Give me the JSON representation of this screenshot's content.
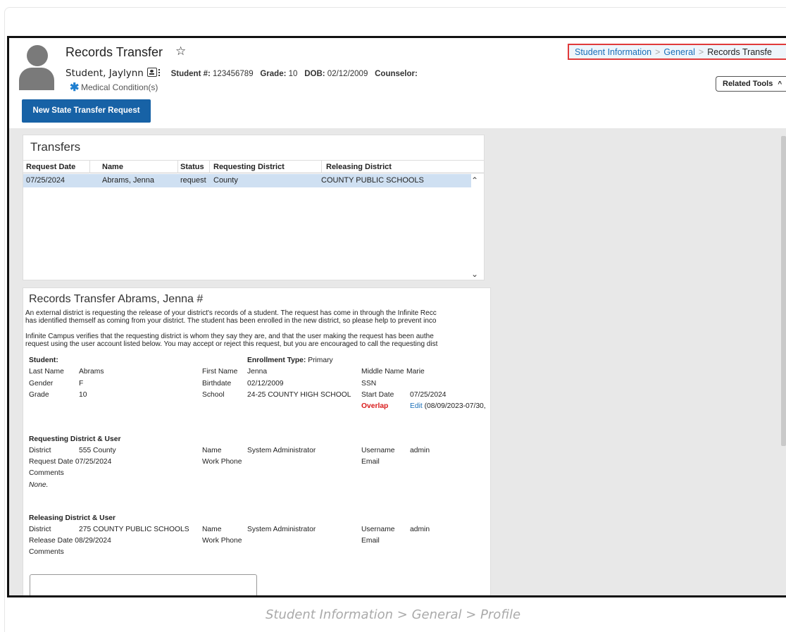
{
  "header": {
    "title": "Records Transfer",
    "student_name": "Student, Jaylynn",
    "student_num_label": "Student #:",
    "student_num": "123456789",
    "grade_label": "Grade:",
    "grade": "10",
    "dob_label": "DOB:",
    "dob": "02/12/2009",
    "counselor_label": "Counselor:",
    "medical": "Medical Condition(s)"
  },
  "breadcrumb": {
    "item1": "Student Information",
    "item2": "General",
    "item3": "Records Transfe"
  },
  "related_tools": "Related Tools",
  "new_button": "New State Transfer Request",
  "transfers": {
    "title": "Transfers",
    "columns": [
      "Request Date",
      "Name",
      "Status",
      "Requesting District",
      "Releasing District"
    ],
    "rows": [
      [
        "07/25/2024",
        "Abrams, Jenna",
        "request",
        "County",
        "COUNTY PUBLIC SCHOOLS"
      ]
    ]
  },
  "records": {
    "title": "Records Transfer Abrams, Jenna #",
    "para1_line1": "An external district is requesting the release of your district's records of a student. The request has come in through the Infinite Recc",
    "para1_line2": "has identified themself as coming from your district. The student has been enrolled in the new district, so please help to prevent inco",
    "para2_line1": "Infinite Campus verifies that the requesting district is whom they say they are, and that the user making the request has been authe",
    "para2_line2": "request using the user account listed below. You may accept or reject this request, but you are encouraged to call the requesting dist",
    "student_label": "Student:",
    "enrollment_type_label": "Enrollment Type:",
    "enrollment_type": "Primary",
    "last_name_label": "Last Name",
    "last_name": "Abrams",
    "first_name_label": "First Name",
    "first_name": "Jenna",
    "middle_name_label": "Middle Name",
    "middle_name": "Marie",
    "gender_label": "Gender",
    "gender": "F",
    "birthdate_label": "Birthdate",
    "birthdate": "02/12/2009",
    "ssn_label": "SSN",
    "grade_label": "Grade",
    "grade": "10",
    "school_label": "School",
    "school": "24-25 COUNTY HIGH SCHOOL",
    "start_date_label": "Start Date",
    "start_date": "07/25/2024",
    "overlap": "Overlap",
    "edit": "Edit",
    "edit_range": "(08/09/2023-07/30,",
    "req_heading": "Requesting District & User",
    "district_label": "District",
    "req_district": "555 County",
    "name_label": "Name",
    "req_name": "System Administrator",
    "username_label": "Username",
    "req_username": "admin",
    "request_date_label": "Request Date",
    "request_date": "07/25/2024",
    "work_phone_label": "Work Phone",
    "email_label": "Email",
    "comments_label": "Comments",
    "req_comments": "None.",
    "rel_heading": "Releasing District & User",
    "rel_district": "275 COUNTY PUBLIC SCHOOLS",
    "rel_name": "System Administrator",
    "rel_username": "admin",
    "release_date_label": "Release Date",
    "release_date": "08/29/2024"
  },
  "caption": "Student Information > General > Profile",
  "colors": {
    "primary": "#1762a6",
    "highlight_border": "#e03a3a",
    "row_selected": "#cfe0f2",
    "overlap": "#d91b1b"
  },
  "icons": [
    "star-icon",
    "contact-card-icon",
    "asterisk-icon",
    "chevron-up-icon",
    "chevron-down-icon"
  ]
}
